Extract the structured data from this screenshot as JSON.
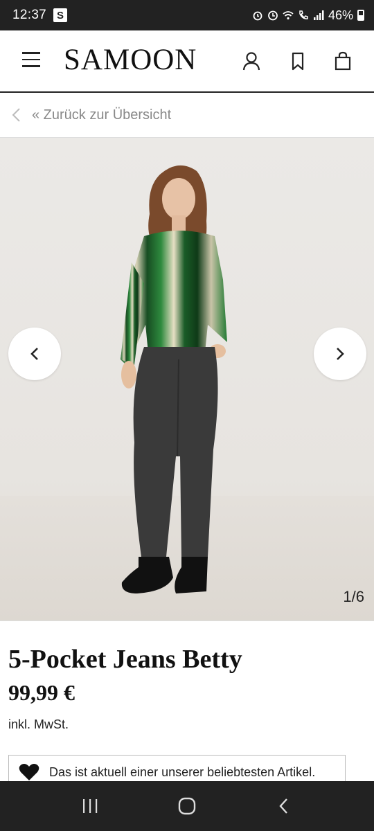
{
  "status_bar": {
    "time": "12:37",
    "app_badge": "S",
    "battery_percent": "46%",
    "icons": [
      "alarm-icon",
      "clock-icon",
      "wifi-icon",
      "call-icon",
      "signal-icon",
      "battery-icon"
    ]
  },
  "header": {
    "logo": "SAMOON",
    "icons": [
      "menu-icon",
      "account-icon",
      "wishlist-icon",
      "cart-icon"
    ]
  },
  "back_link": {
    "label": "« Zurück zur Übersicht"
  },
  "gallery": {
    "counter": "1/6",
    "current_image": 1,
    "total_images": 6
  },
  "product": {
    "title": "5-Pocket Jeans Betty",
    "price": "99,99 €",
    "tax_note": "inkl. MwSt.",
    "popular_note": "Das ist aktuell einer unserer beliebtesten Artikel."
  },
  "colors": {
    "accent_dark": "#222222",
    "muted_text": "#888888",
    "background": "#ffffff"
  }
}
